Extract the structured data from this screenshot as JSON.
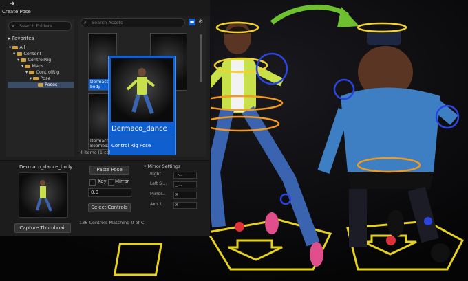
{
  "toolbar": {
    "create_pose_label": "Create Pose",
    "create_icon": "pose-icon"
  },
  "folders": {
    "search_placeholder": "Search Folders",
    "favorites_label": "Favorites",
    "tree": [
      {
        "label": "All",
        "depth": 0
      },
      {
        "label": "Content",
        "depth": 1
      },
      {
        "label": "ControlRig",
        "depth": 2
      },
      {
        "label": "Maps",
        "depth": 3
      },
      {
        "label": "ControlRig",
        "depth": 4
      },
      {
        "label": "Pose",
        "depth": 5
      },
      {
        "label": "Poses",
        "depth": 6,
        "selected": true
      }
    ]
  },
  "assets": {
    "search_placeholder": "Search Assets",
    "thumbs": [
      {
        "caption": "Dermaco_dance\nbody",
        "sub": "Control Rig Pose",
        "selected": true
      },
      {
        "caption": "",
        "sub": ""
      },
      {
        "caption": "Dermaco_\nBoomboa...",
        "sub": ""
      },
      {
        "caption": "",
        "sub": ""
      }
    ],
    "items_count": "4 items (1 sel"
  },
  "tooltip": {
    "title": "Dermaco_dance",
    "type": "Control Rig Pose"
  },
  "bottom": {
    "pose_title": "Dermaco_dance_body",
    "paste_pose": "Paste Pose",
    "key_label": "Key",
    "mirror_label": "Mirror",
    "value": "0.0",
    "select_controls": "Select Controls",
    "matching": "136 Controls Matching 0 of C",
    "capture_thumbnail": "Capture Thumbnail"
  },
  "mirror_settings": {
    "title": "Mirror Settings",
    "rows": [
      {
        "label": "Right...",
        "value": "_r..."
      },
      {
        "label": "Left Si...",
        "value": "_l..."
      },
      {
        "label": "Mirror...",
        "value": "X"
      },
      {
        "label": "Axis t...",
        "value": "X"
      }
    ]
  },
  "colors": {
    "accent": "#0f5fd0",
    "arrow": "#6dc12f",
    "floor": "#e6d21e"
  }
}
